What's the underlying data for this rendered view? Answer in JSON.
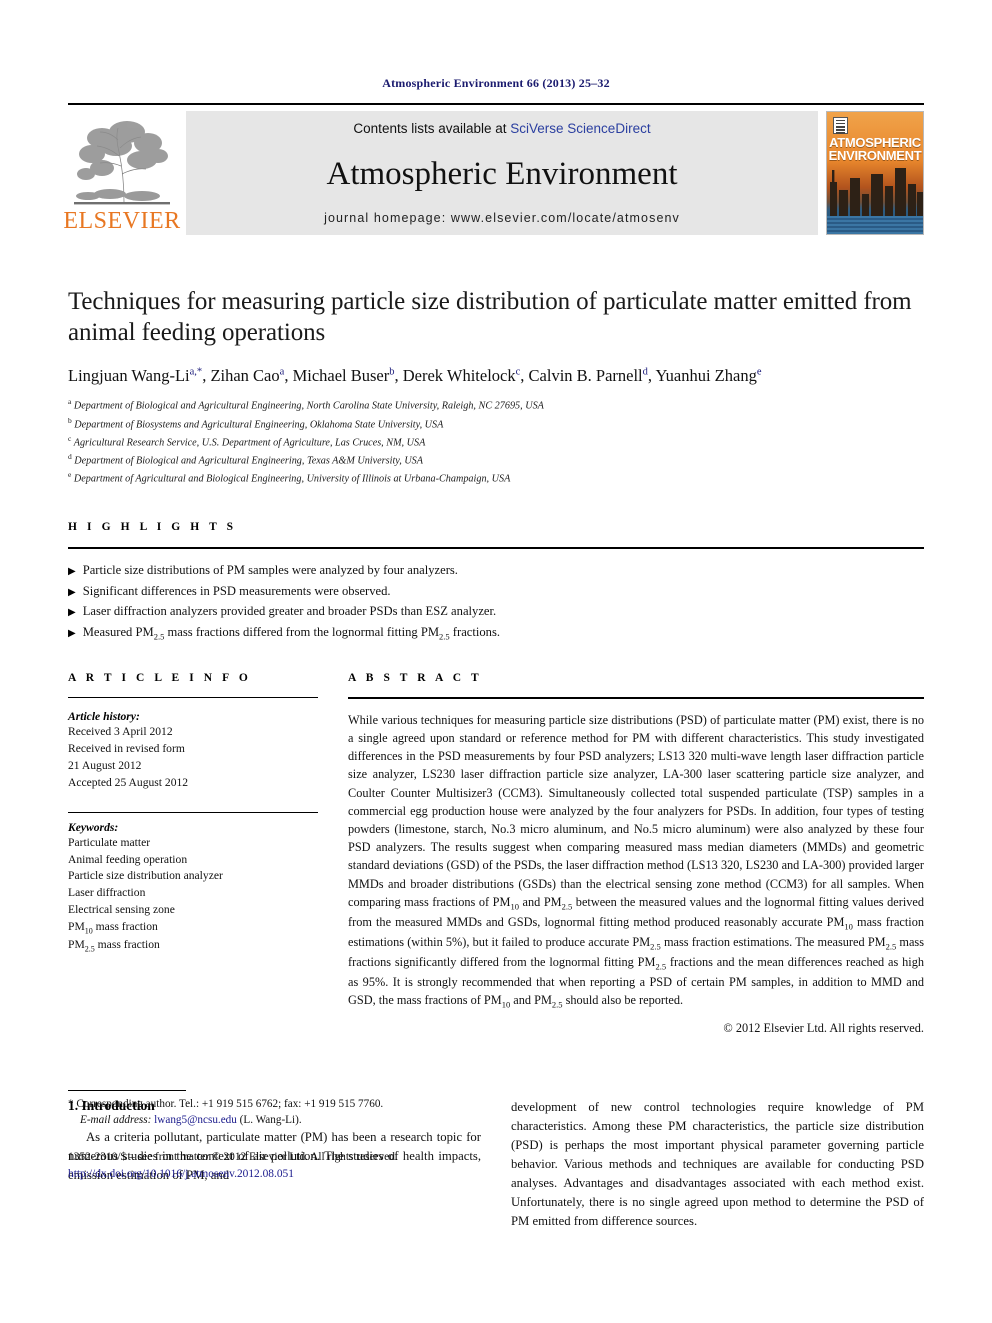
{
  "running_head": "Atmospheric Environment 66 (2013) 25–32",
  "masthead": {
    "publisher_name": "ELSEVIER",
    "contents_prefix": "Contents lists available at ",
    "sciencedirect_link": "SciVerse ScienceDirect",
    "journal_title": "Atmospheric Environment",
    "homepage": "journal homepage: www.elsevier.com/locate/atmosenv",
    "cover_title_line1": "ATMOSPHERIC",
    "cover_title_line2": "ENVIRONMENT",
    "accent_orange": "#E87722",
    "link_blue": "#2b3fa0"
  },
  "article": {
    "title": "Techniques for measuring particle size distribution of particulate matter emitted from animal feeding operations",
    "authors": [
      {
        "name": "Lingjuan Wang-Li",
        "sup": "a,*"
      },
      {
        "name": "Zihan Cao",
        "sup": "a"
      },
      {
        "name": "Michael Buser",
        "sup": "b"
      },
      {
        "name": "Derek Whitelock",
        "sup": "c"
      },
      {
        "name": "Calvin B. Parnell",
        "sup": "d"
      },
      {
        "name": "Yuanhui Zhang",
        "sup": "e"
      }
    ],
    "affiliations": [
      {
        "sup": "a",
        "text": "Department of Biological and Agricultural Engineering, North Carolina State University, Raleigh, NC 27695, USA"
      },
      {
        "sup": "b",
        "text": "Department of Biosystems and Agricultural Engineering, Oklahoma State University, USA"
      },
      {
        "sup": "c",
        "text": "Agricultural Research Service, U.S. Department of Agriculture, Las Cruces, NM, USA"
      },
      {
        "sup": "d",
        "text": "Department of Biological and Agricultural Engineering, Texas A&M University, USA"
      },
      {
        "sup": "e",
        "text": "Department of Agricultural and Biological Engineering, University of Illinois at Urbana-Champaign, USA"
      }
    ]
  },
  "highlights": {
    "heading": "H I G H L I G H T S",
    "bullet_glyph": "▶",
    "items": [
      "Particle size distributions of PM samples were analyzed by four analyzers.",
      "Significant differences in PSD measurements were observed.",
      "Laser diffraction analyzers provided greater and broader PSDs than ESZ analyzer.",
      "Measured PM2.5 mass fractions differed from the lognormal fitting PM2.5 fractions."
    ]
  },
  "article_info": {
    "heading": "A R T I C L E  I N F O",
    "history_label": "Article history:",
    "history": [
      "Received 3 April 2012",
      "Received in revised form",
      "21 August 2012",
      "Accepted 25 August 2012"
    ],
    "keywords_label": "Keywords:",
    "keywords": [
      "Particulate matter",
      "Animal feeding operation",
      "Particle size distribution analyzer",
      "Laser diffraction",
      "Electrical sensing zone",
      "PM10 mass fraction",
      "PM2.5 mass fraction"
    ]
  },
  "abstract": {
    "heading": "A B S T R A C T",
    "text": "While various techniques for measuring particle size distributions (PSD) of particulate matter (PM) exist, there is no a single agreed upon standard or reference method for PM with different characteristics. This study investigated differences in the PSD measurements by four PSD analyzers; LS13 320 multi-wave length laser diffraction particle size analyzer, LS230 laser diffraction particle size analyzer, LA-300 laser scattering particle size analyzer, and Coulter Counter Multisizer3 (CCM3). Simultaneously collected total suspended particulate (TSP) samples in a commercial egg production house were analyzed by the four analyzers for PSDs. In addition, four types of testing powders (limestone, starch, No.3 micro aluminum, and No.5 micro aluminum) were also analyzed by these four PSD analyzers. The results suggest when comparing measured mass median diameters (MMDs) and geometric standard deviations (GSD) of the PSDs, the laser diffraction method (LS13 320, LS230 and LA-300) provided larger MMDs and broader distributions (GSDs) than the electrical sensing zone method (CCM3) for all samples. When comparing mass fractions of PM10 and PM2.5 between the measured values and the lognormal fitting values derived from the measured MMDs and GSDs, lognormal fitting method produced reasonably accurate PM10 mass fraction estimations (within 5%), but it failed to produce accurate PM2.5 mass fraction estimations. The measured PM2.5 mass fractions significantly differed from the lognormal fitting PM2.5 fractions and the mean differences reached as high as 95%. It is strongly recommended that when reporting a PSD of certain PM samples, in addition to MMD and GSD, the mass fractions of PM10 and PM2.5 should also be reported.",
    "copyright": "© 2012 Elsevier Ltd. All rights reserved."
  },
  "introduction": {
    "heading": "1.  Introduction",
    "left_paragraph": "As a criteria pollutant, particulate matter (PM) has been a research topic for numerous studies in the context of air pollution. The studies of health impacts, emission estimation of PM, and",
    "right_paragraph": "development of new control technologies require knowledge of PM characteristics. Among these PM characteristics, the particle size distribution (PSD) is perhaps the most important physical parameter governing particle behavior. Various methods and techniques are available for conducting PSD analyses. Advantages and disadvantages associated with each method exist. Unfortunately, there is no single agreed upon method to determine the PSD of PM emitted from difference sources."
  },
  "footnotes": {
    "corresponding": "* Corresponding author. Tel.: +1 919 515 6762; fax: +1 919 515 7760.",
    "email_label": "E-mail address:",
    "email": "lwang5@ncsu.edu",
    "email_owner": "(L. Wang-Li).",
    "issn_line": "1352-2310/$ – see front matter © 2012 Elsevier Ltd. All rights reserved.",
    "doi": "http://dx.doi.org/10.1016/j.atmosenv.2012.08.051"
  }
}
